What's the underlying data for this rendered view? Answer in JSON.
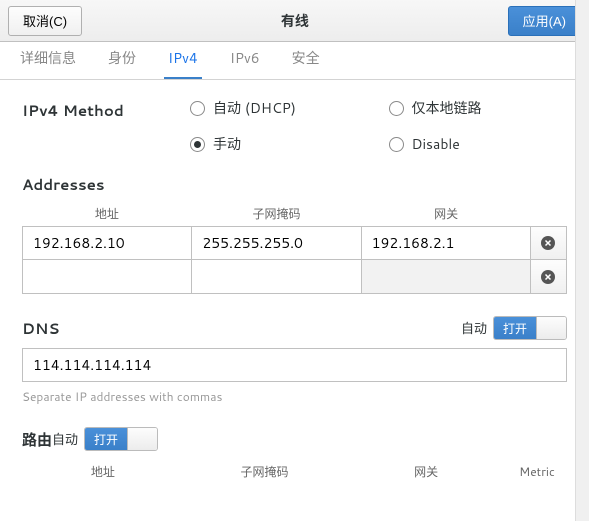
{
  "header": {
    "cancel": "取消(C)",
    "title": "有线",
    "apply": "应用(A)"
  },
  "tabs": {
    "details": "详细信息",
    "identity": "身份",
    "ipv4": "IPv4",
    "ipv6": "IPv6",
    "security": "安全"
  },
  "ipv4": {
    "method_label": "IPv4 Method",
    "radios": {
      "dhcp": "自动 (DHCP)",
      "linklocal": "仅本地链路",
      "manual": "手动",
      "disable": "Disable"
    },
    "addresses": {
      "title": "Addresses",
      "col_address": "地址",
      "col_netmask": "子网掩码",
      "col_gateway": "网关",
      "rows": [
        {
          "address": "192.168.2.10",
          "netmask": "255.255.255.0",
          "gateway": "192.168.2.1"
        },
        {
          "address": "",
          "netmask": "",
          "gateway": ""
        }
      ]
    },
    "dns": {
      "title": "DNS",
      "auto_label": "自动",
      "switch_on": "打开",
      "value": "114.114.114.114",
      "help": "Separate IP addresses with commas"
    },
    "routes": {
      "title": "路由",
      "auto_label": "自动",
      "switch_on": "打开",
      "col_address": "地址",
      "col_netmask": "子网掩码",
      "col_gateway": "网关",
      "col_metric": "Metric"
    }
  }
}
